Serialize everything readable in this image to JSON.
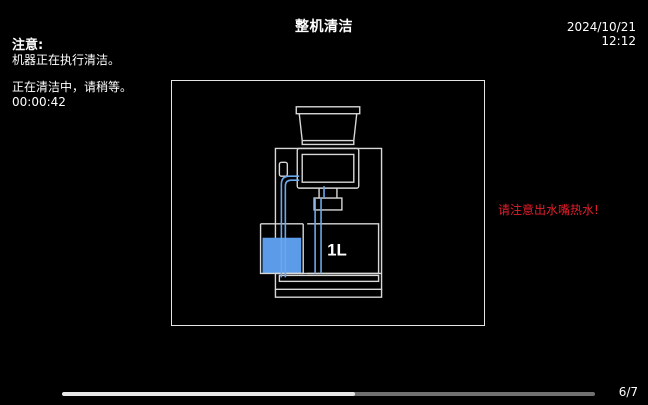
{
  "header": {
    "title": "整机清洁",
    "date": "2024/10/21",
    "time": "12:12"
  },
  "notice": {
    "heading": "注意:",
    "line1": "机器正在执行清洁。",
    "line2": "正在清洁中，请稍等。",
    "elapsed": "00:00:42"
  },
  "illustration": {
    "tank_label": "1L",
    "water_color": "#5b9be8"
  },
  "warning": {
    "text": "请注意出水嘴热水!",
    "color": "#e41e2b"
  },
  "progress": {
    "fraction": 0.55
  },
  "pager": {
    "label": "6/7"
  }
}
